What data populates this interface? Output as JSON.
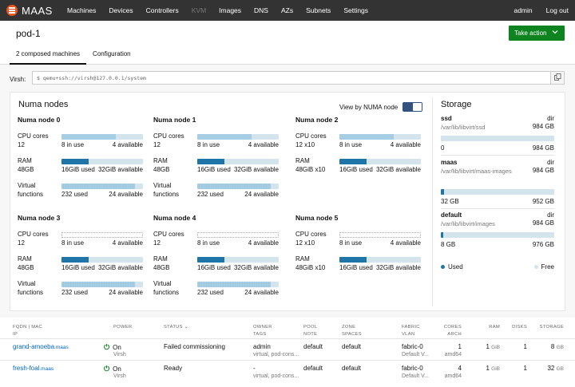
{
  "nav": {
    "brand": "MAAS",
    "items": [
      "Machines",
      "Devices",
      "Controllers",
      "KVM",
      "Images",
      "DNS",
      "AZs",
      "Subnets",
      "Settings"
    ],
    "user": "admin",
    "logout": "Log out"
  },
  "header": {
    "title": "pod-1",
    "action": "Take action",
    "tabs": [
      "2 composed machines",
      "Configuration"
    ]
  },
  "virsh": {
    "label": "Virsh:",
    "address": "$ qemu+ssh://virsh@127.0.0.1/system"
  },
  "numa": {
    "title": "Numa nodes",
    "toggle_label": "View by NUMA node",
    "toggle_on": true,
    "labels": {
      "cpu": "CPU cores",
      "ram": "RAM",
      "vf1": "Virtual",
      "vf2": "functions"
    },
    "nodes": [
      {
        "name": "Numa node 0",
        "cores": "12",
        "cpu_used": "8 in use",
        "cpu_avail": "4 available",
        "cpu_fraction": 0.67,
        "ram_size": "48GB",
        "ram_used": "16GiB used",
        "ram_avail": "32GiB available",
        "ram_fraction": 0.33,
        "vf_used": "232 used",
        "vf_avail": "24 available",
        "vf_fraction": 0.9
      },
      {
        "name": "Numa node 1",
        "cores": "12",
        "cpu_used": "8 in use",
        "cpu_avail": "4 available",
        "cpu_fraction": 0.67,
        "ram_size": "48GB",
        "ram_used": "16GiB used",
        "ram_avail": "32GiB available",
        "ram_fraction": 0.33,
        "vf_used": "232 used",
        "vf_avail": "24 available",
        "vf_fraction": 0.9
      },
      {
        "name": "Numa node 2",
        "cores": "12 x10",
        "cpu_used": "8 in use",
        "cpu_avail": "4 available",
        "cpu_fraction": 0.67,
        "ram_size": "48GiB x10",
        "ram_used": "16GiB used",
        "ram_avail": "32GiB available",
        "ram_fraction": 0.33,
        "vf_used": "",
        "vf_avail": "",
        "vf_fraction": null
      },
      {
        "name": "Numa node 3",
        "cores": "12",
        "cpu_used": "8 in use",
        "cpu_avail": "4 available",
        "cpu_fraction": 0,
        "ram_size": "48GB",
        "ram_used": "16GiB used",
        "ram_avail": "32GiB available",
        "ram_fraction": 0.33,
        "vf_used": "232 used",
        "vf_avail": "24 available",
        "vf_fraction": 0.9
      },
      {
        "name": "Numa node 4",
        "cores": "12",
        "cpu_used": "8 in use",
        "cpu_avail": "4 available",
        "cpu_fraction": 0,
        "ram_size": "48GB",
        "ram_used": "16GiB used",
        "ram_avail": "32GiB available",
        "ram_fraction": 0.33,
        "vf_used": "232 used",
        "vf_avail": "24 available",
        "vf_fraction": 0.9
      },
      {
        "name": "Numa node 5",
        "cores": "12 x10",
        "cpu_used": "8 in use",
        "cpu_avail": "4 available",
        "cpu_fraction": 0,
        "ram_size": "48GiB x10",
        "ram_used": "16GiB used",
        "ram_avail": "32GiB available",
        "ram_fraction": 0.33,
        "vf_used": "",
        "vf_avail": "",
        "vf_fraction": null
      }
    ]
  },
  "storage": {
    "title": "Storage",
    "pools": [
      {
        "name": "ssd",
        "type": "dir",
        "path": "/var/lib/libvirt/ssd",
        "size": "984 GB",
        "used": "0",
        "total": "984 GB",
        "fraction": 0.0
      },
      {
        "name": "maas",
        "type": "dir",
        "path": "/var/lib/libvirt/maas-images",
        "size": "984 GB",
        "used": "32 GB",
        "total": "952 GB",
        "fraction": 0.03
      },
      {
        "name": "default",
        "type": "dir",
        "path": "/var/lib/libvirt/images",
        "size": "984 GB",
        "used": "8 GB",
        "total": "976 GB",
        "fraction": 0.01
      }
    ],
    "legend_used": "Used",
    "legend_free": "Free"
  },
  "table": {
    "headers": {
      "fqdn1": "FQDN | MAC",
      "fqdn2": "IP",
      "power": "POWER",
      "status": "STATUS",
      "owner1": "OWNER",
      "owner2": "TAGS",
      "pool1": "POOL",
      "pool2": "NOTE",
      "zone1": "ZONE",
      "zone2": "SPACES",
      "fabric1": "FABRIC",
      "fabric2": "VLAN",
      "cores1": "CORES",
      "cores2": "ARCH",
      "ram": "RAM",
      "disks": "DISKS",
      "storage": "STORAGE"
    },
    "rows": [
      {
        "host": "grand-amoeba",
        "domain": ".maas",
        "power": "On",
        "power_type": "Virsh",
        "status": "Failed commissioning",
        "owner": "admin",
        "tags": "virtual, pod-cons...",
        "pool": "default",
        "zone": "default",
        "fabric": "fabric-0",
        "vlan": "Default V...",
        "cores": "1",
        "arch": "amd64",
        "ram": "1",
        "ram_unit": "GiB",
        "disks": "1",
        "storage": "8",
        "storage_unit": "GB"
      },
      {
        "host": "fresh-foal",
        "domain": ".maas",
        "power": "On",
        "power_type": "Virsh",
        "status": "Ready",
        "owner": "-",
        "tags": "virtual, pod-cons...",
        "pool": "default",
        "zone": "default",
        "fabric": "fabric-0",
        "vlan": "Default V...",
        "cores": "4",
        "arch": "amd64",
        "ram": "1",
        "ram_unit": "GiB",
        "disks": "1",
        "storage": "32",
        "storage_unit": "GB"
      }
    ]
  }
}
